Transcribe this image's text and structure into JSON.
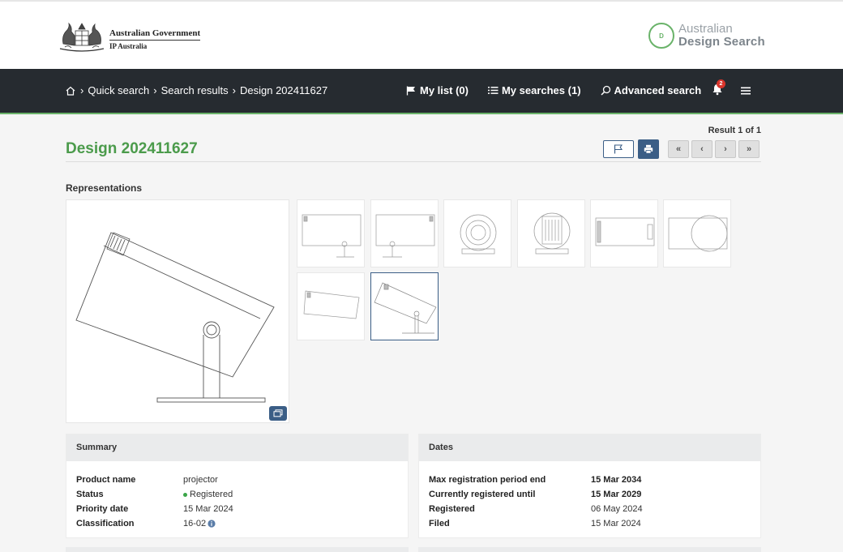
{
  "header": {
    "gov_line1": "Australian Government",
    "gov_line2": "IP Australia",
    "ads_mark": "D",
    "ads_line1": "Australian",
    "ads_line2": "Design Search"
  },
  "nav": {
    "breadcrumb": [
      "Quick search",
      "Search results",
      "Design 202411627"
    ],
    "links": [
      {
        "label": "My list (0)",
        "icon": "flag-icon"
      },
      {
        "label": "My searches (1)",
        "icon": "list-icon"
      },
      {
        "label": "Advanced search",
        "icon": "search-icon"
      }
    ],
    "notification_count": "2"
  },
  "title": {
    "result_count": "Result 1 of 1",
    "heading": "Design 202411627",
    "pager": [
      "«",
      "‹",
      "›",
      "»"
    ]
  },
  "representations": {
    "heading": "Representations",
    "thumbnail_count": 8,
    "selected_index": 7
  },
  "summary": {
    "heading": "Summary",
    "rows": [
      {
        "key": "Product name",
        "value": "projector"
      },
      {
        "key": "Status",
        "value": "Registered"
      },
      {
        "key": "Priority date",
        "value": "15 Mar 2024"
      },
      {
        "key": "Classification",
        "value": "16-02"
      }
    ]
  },
  "dates": {
    "heading": "Dates",
    "rows": [
      {
        "key": "Max registration period end",
        "value": "15 Mar 2034"
      },
      {
        "key": "Currently registered until",
        "value": "15 Mar 2029"
      },
      {
        "key": "Registered",
        "value": "06 May 2024"
      },
      {
        "key": "Filed",
        "value": "15 Mar 2024"
      }
    ]
  },
  "colors": {
    "accent_green": "#4b9b4b",
    "nav_dark": "#262b30",
    "button_blue": "#3b5e86",
    "status_green": "#3aa548",
    "badge_red": "#d9342b"
  }
}
